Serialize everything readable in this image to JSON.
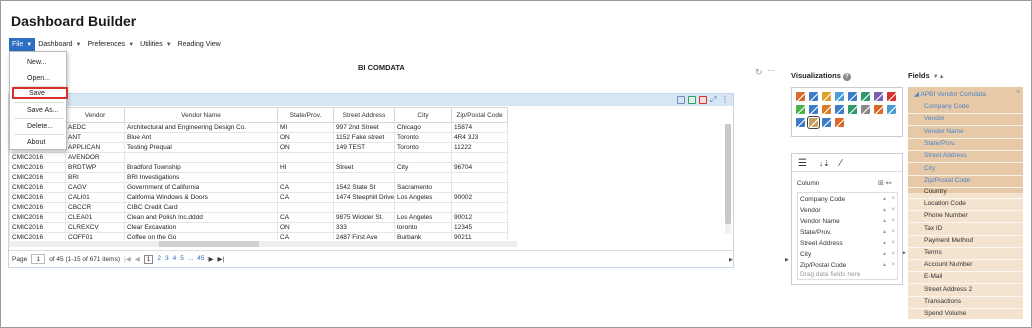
{
  "app": {
    "title": "Dashboard Builder"
  },
  "menubar": [
    {
      "label": "File",
      "active": true
    },
    {
      "label": "Dashboard",
      "active": false
    },
    {
      "label": "Preferences",
      "active": false
    },
    {
      "label": "Utilities",
      "active": false
    },
    {
      "label": "Reading View",
      "active": false
    }
  ],
  "file_menu": {
    "items": [
      "New...",
      "Open...",
      "Save",
      "Save As...",
      "Delete...",
      "About"
    ],
    "highlighted": "Save"
  },
  "report": {
    "title": "BI COMDATA",
    "columns": [
      "",
      "Vendor",
      "Vendor Name",
      "State/Prov.",
      "Street Address",
      "City",
      "Zip/Postal Code"
    ],
    "rows": [
      [
        "",
        "AEDC",
        "Architectural and Engineering Design Co.",
        "MI",
        "997 2nd Street",
        "Chicago",
        "15874"
      ],
      [
        "",
        "ANT",
        "Blue Ant",
        "ON",
        "1152 Fake street",
        "Toronto",
        "4R4 3J3"
      ],
      [
        "",
        "APPLICAN",
        "Testing Prequal",
        "ON",
        "149 TEST",
        "Toronto",
        "11222"
      ],
      [
        "CMIC2016",
        "AVENDOR",
        "",
        "",
        "",
        "",
        ""
      ],
      [
        "CMIC2016",
        "BRDTWP",
        "Bradford Township",
        "HI",
        "Street",
        "City",
        "96704"
      ],
      [
        "CMIC2016",
        "BRI",
        "BRI Investigations",
        "",
        "",
        "",
        ""
      ],
      [
        "CMIC2016",
        "CAGV",
        "Government of California",
        "CA",
        "1542 State St",
        "Sacramento",
        ""
      ],
      [
        "CMIC2016",
        "CALI01",
        "California Windows & Doors",
        "CA",
        "1474 Steephill Drive",
        "Los Angeles",
        "90002"
      ],
      [
        "CMIC2016",
        "CBCCR",
        "CIBC Credit Card",
        "",
        "",
        "",
        ""
      ],
      [
        "CMIC2016",
        "CLEA01",
        "Clean and Polish Inc.dddd",
        "CA",
        "9875 Wickler St.",
        "Los Angeles",
        "90012"
      ],
      [
        "CMIC2016",
        "CLREXCV",
        "Clear Excavation",
        "ON",
        "333",
        "toronto",
        "12345"
      ],
      [
        "CMIC2016",
        "COFF01",
        "Coffee on the Go",
        "CA",
        "2487 First Ave",
        "Burbank",
        "90211"
      ]
    ],
    "pager": {
      "page_label": "Page",
      "page_value": "1",
      "summary": "of 45  (1-15 of 671 items)",
      "pages": [
        "1",
        "2",
        "3",
        "4",
        "5",
        "...",
        "45"
      ],
      "current": "1"
    }
  },
  "visualizations": {
    "title": "Visualizations",
    "help": "?",
    "icons": [
      {
        "name": "table-viz-icon",
        "color": "#d96a2b"
      },
      {
        "name": "bar-chart-viz-icon",
        "color": "#3d7cc9"
      },
      {
        "name": "column-chart-viz-icon",
        "color": "#e0a030"
      },
      {
        "name": "stacked-bar-viz-icon",
        "color": "#4a9ed6"
      },
      {
        "name": "stacked-column-viz-icon",
        "color": "#3d7cc9"
      },
      {
        "name": "grouped-column-viz-icon",
        "color": "#2f9a6d"
      },
      {
        "name": "line-chart-viz-icon",
        "color": "#7a5fb0"
      },
      {
        "name": "gauge-viz-icon",
        "color": "#d9322e"
      },
      {
        "name": "map-viz-icon",
        "color": "#4db04a"
      },
      {
        "name": "area-chart-viz-icon",
        "color": "#3d7cc9"
      },
      {
        "name": "pie-chart-viz-icon",
        "color": "#e07a2b"
      },
      {
        "name": "donut-chart-viz-icon",
        "color": "#3d7cc9"
      },
      {
        "name": "funnel-viz-icon",
        "color": "#2f9a6d"
      },
      {
        "name": "scatter-viz-icon",
        "color": "#8a8a8a"
      },
      {
        "name": "bubble-viz-icon",
        "color": "#d96a2b"
      },
      {
        "name": "heatmap-viz-icon",
        "color": "#4a9ed6"
      },
      {
        "name": "kpi-number-viz-icon",
        "color": "#3d7cc9"
      },
      {
        "name": "grid-viz-icon",
        "color": "#c8a060"
      },
      {
        "name": "text-viz-icon",
        "color": "#3d7cc9"
      },
      {
        "name": "pivot-viz-icon",
        "color": "#d96a2b"
      }
    ]
  },
  "properties": {
    "column_label": "Column",
    "columns": [
      "Company Code",
      "Vendor",
      "Vendor Name",
      "State/Prov.",
      "Street Address",
      "City",
      "Zip/Postal Code"
    ],
    "drop_hint": "Drag data fields here"
  },
  "fields": {
    "title": "Fields",
    "source": "APBI Vendor Comdata",
    "selected": [
      "Company Code",
      "Vendor",
      "Vendor Name",
      "State/Prov.",
      "Street Address",
      "City",
      "Zip/Postal Code"
    ],
    "unselected": [
      "Country",
      "Location Code",
      "Phone Number",
      "Tax ID",
      "Payment Method",
      "Terms",
      "Account Number",
      "E-Mail",
      "Street Address 2",
      "Transactions",
      "Spend Volume"
    ]
  }
}
